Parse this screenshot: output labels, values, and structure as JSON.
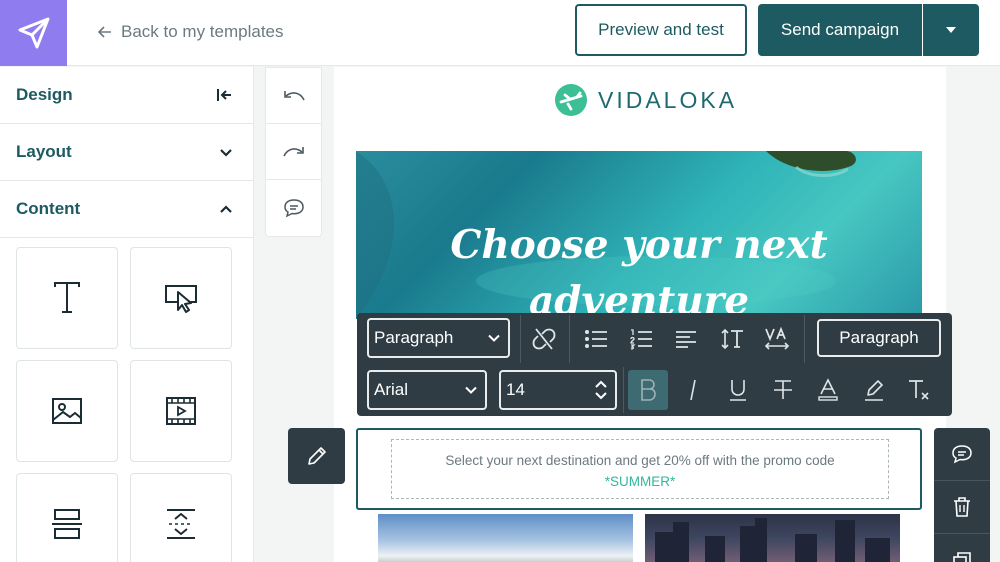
{
  "topbar": {
    "back_label": "Back to my templates",
    "preview_label": "Preview and test",
    "send_label": "Send campaign"
  },
  "sidebar": {
    "sections": [
      {
        "label": "Design",
        "icon": "collapse-left-icon"
      },
      {
        "label": "Layout",
        "icon": "chevron-down-icon"
      },
      {
        "label": "Content",
        "icon": "chevron-up-icon"
      }
    ],
    "tiles": [
      "text-block-icon",
      "button-block-icon",
      "image-block-icon",
      "video-block-icon",
      "divider-block-icon",
      "spacer-block-icon"
    ]
  },
  "history": [
    "undo-icon",
    "redo-icon",
    "comment-icon"
  ],
  "email": {
    "brand": "VIDALOKA",
    "hero_title_line1": "Choose your next",
    "hero_title_line2": "adventure",
    "promo_text": "Select your next destination and get 20% off with the promo code",
    "promo_code": "*SUMMER*"
  },
  "toolbar": {
    "block_type": "Paragraph",
    "font": "Arial",
    "font_size": "14",
    "style_button": "Paragraph"
  },
  "colors": {
    "brand_primary": "#1d5a62",
    "logo_bg": "#8f7df0",
    "toolbar_bg": "#2f3c44",
    "promo_accent": "#2fb89a"
  }
}
